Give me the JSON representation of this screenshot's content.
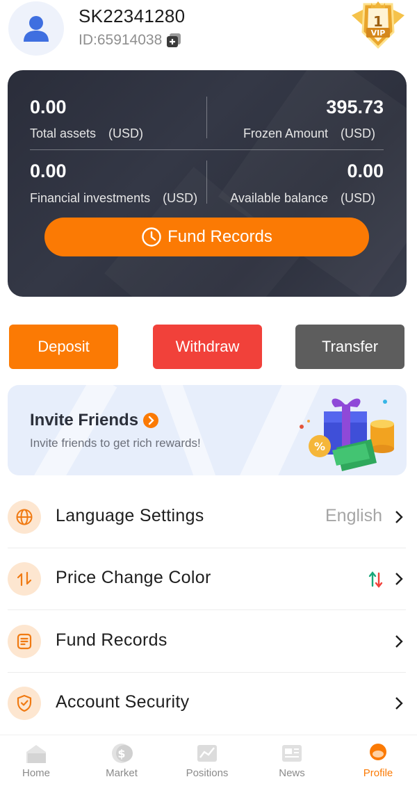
{
  "header": {
    "username": "SK22341280",
    "user_id": "ID:65914038",
    "vip_badge": {
      "level": "1",
      "text": "VIP"
    }
  },
  "assets": {
    "total_assets": {
      "value": "0.00",
      "label": "Total assets　(USD)"
    },
    "frozen_amount": {
      "value": "395.73",
      "label": "Frozen Amount　(USD)"
    },
    "financial_investments": {
      "value": "0.00",
      "label": "Financial investments　(USD)"
    },
    "available_balance": {
      "value": "0.00",
      "label": "Available balance　(USD)"
    },
    "fund_records_button": "Fund Records"
  },
  "actions": {
    "deposit": "Deposit",
    "withdraw": "Withdraw",
    "transfer": "Transfer"
  },
  "invite": {
    "title": "Invite Friends",
    "subtitle": "Invite friends to get rich rewards!"
  },
  "menu": {
    "items": [
      {
        "label": "Language Settings",
        "value": "English",
        "icon": "globe-icon"
      },
      {
        "label": "Price Change Color",
        "value": "",
        "icon": "price-change-icon"
      },
      {
        "label": "Fund Records",
        "value": "",
        "icon": "document-icon"
      },
      {
        "label": "Account Security",
        "value": "",
        "icon": "shield-icon"
      }
    ]
  },
  "nav": {
    "items": [
      {
        "label": "Home",
        "icon": "home-icon"
      },
      {
        "label": "Market",
        "icon": "market-icon"
      },
      {
        "label": "Positions",
        "icon": "positions-icon"
      },
      {
        "label": "News",
        "icon": "news-icon"
      },
      {
        "label": "Profile",
        "icon": "profile-icon"
      }
    ],
    "active": "Profile"
  },
  "colors": {
    "accent": "#fb7a04",
    "withdraw": "#f1413a",
    "transfer": "#5d5d5d",
    "card_bg": "#2f3240",
    "price_up": "#1aa77a",
    "price_down": "#f1413a"
  }
}
